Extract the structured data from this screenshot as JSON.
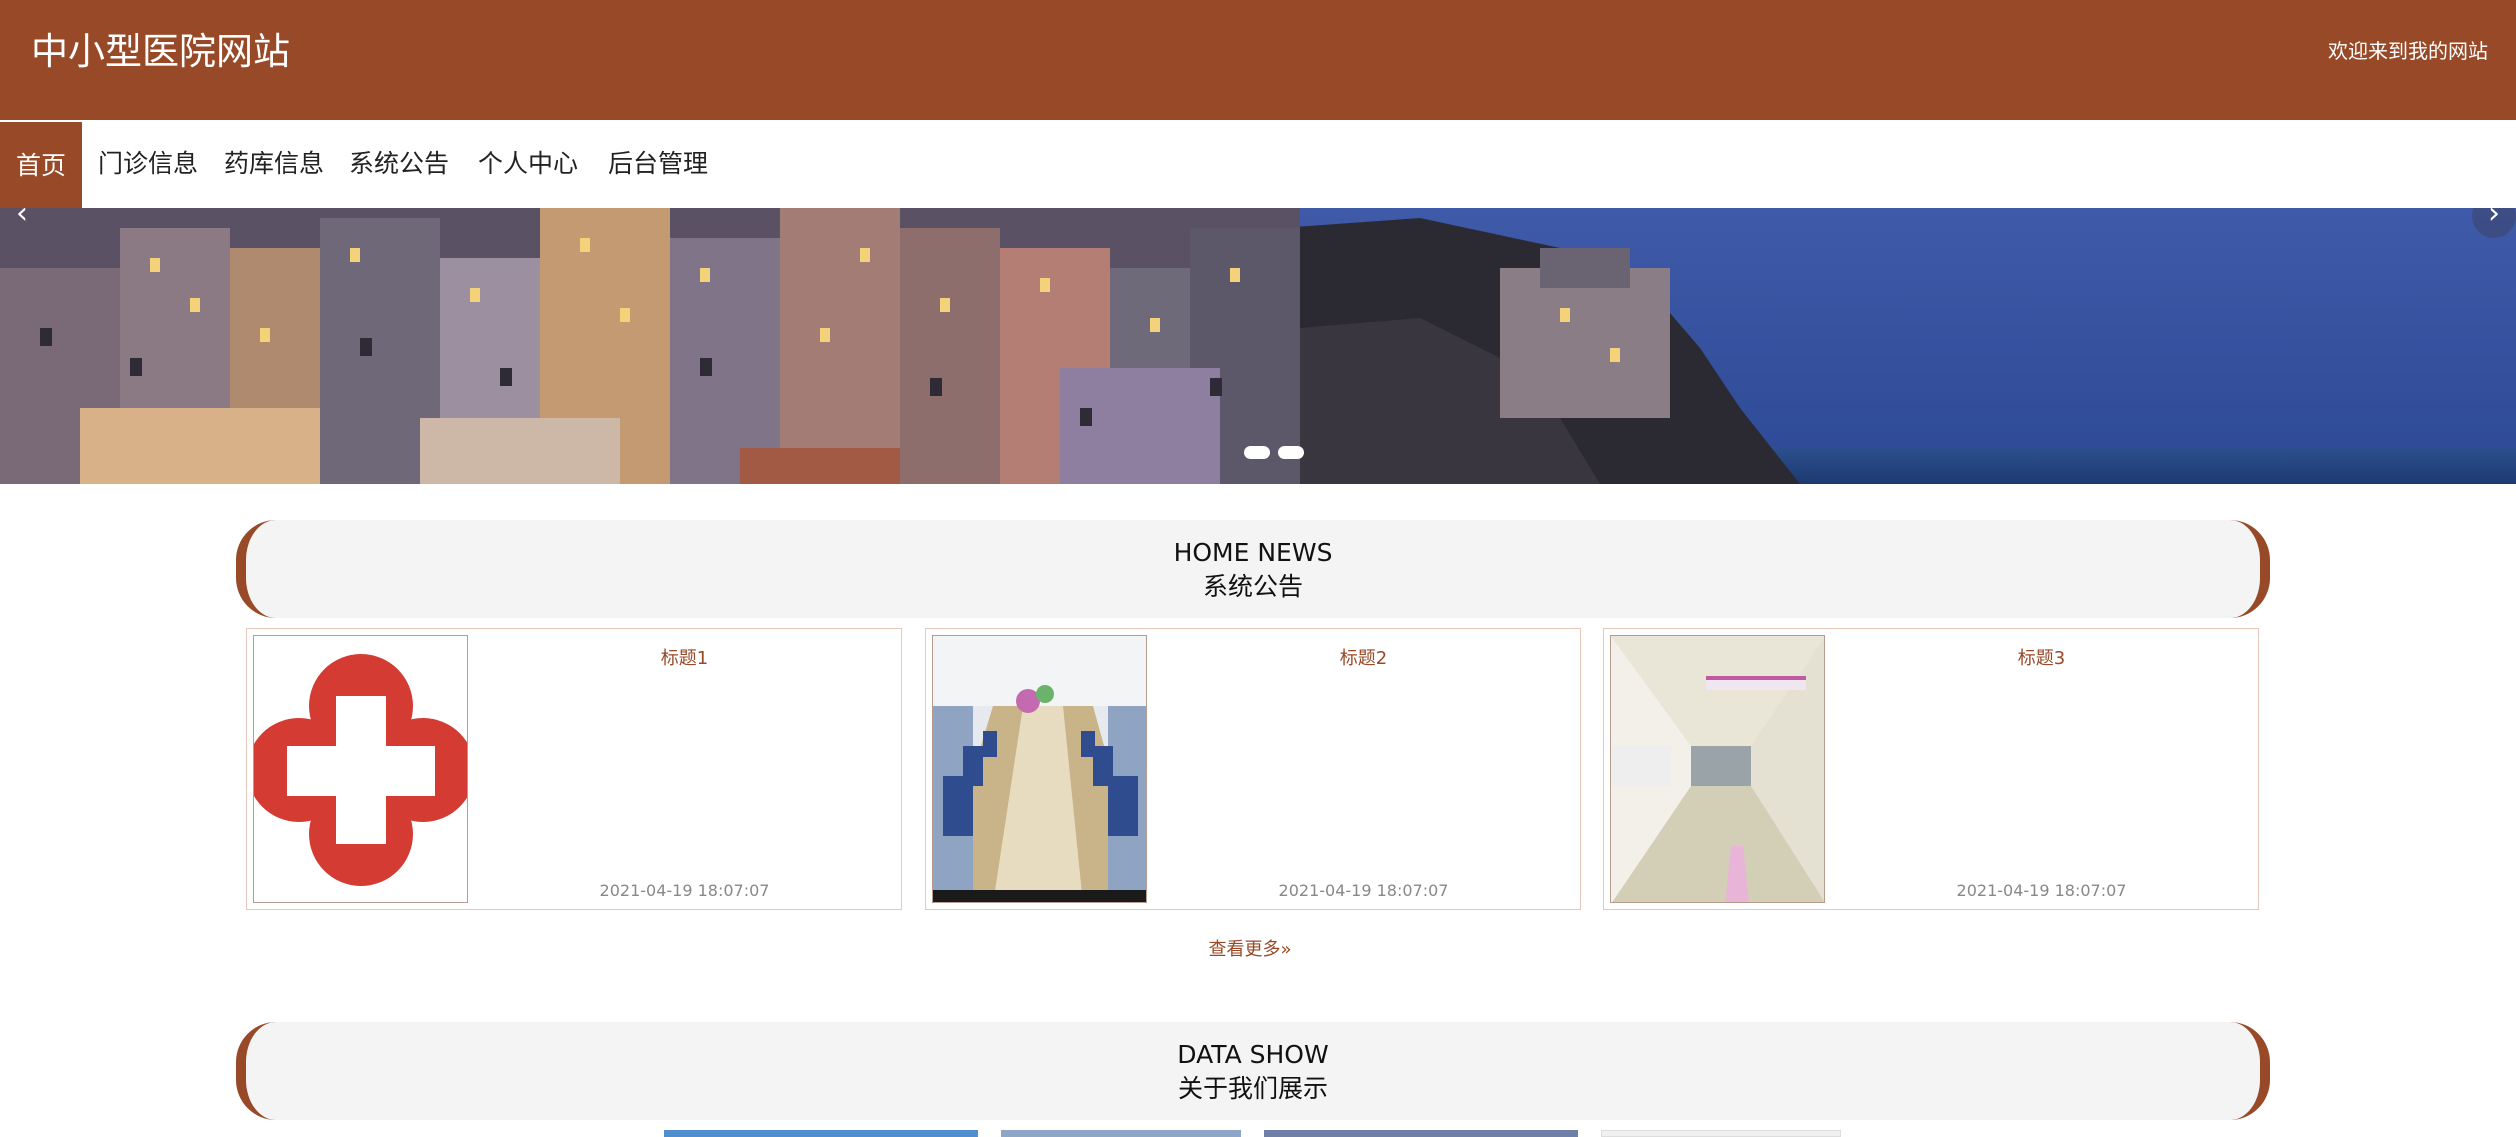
{
  "header": {
    "site_title": "中小型医院网站",
    "welcome": "欢迎来到我的网站"
  },
  "nav": {
    "items": [
      "首页",
      "门诊信息",
      "药库信息",
      "系统公告",
      "个人中心",
      "后台管理"
    ],
    "active_index": 0
  },
  "banner": {
    "prev_icon": "chevron-left-icon",
    "next_icon": "chevron-right-icon",
    "slide_count": 2,
    "active_slide": 0
  },
  "news": {
    "title_en": "HOME NEWS",
    "title_cn": "系统公告",
    "cards": [
      {
        "title": "标题1",
        "date": "2021-04-19 18:07:07",
        "image": "red-cross-logo"
      },
      {
        "title": "标题2",
        "date": "2021-04-19 18:07:07",
        "image": "infusion-room-photo"
      },
      {
        "title": "标题3",
        "date": "2021-04-19 18:07:07",
        "image": "hospital-corridor-photo"
      }
    ],
    "more_label": "查看更多",
    "more_icon": "double-chevron-right-icon"
  },
  "data_show": {
    "title_en": "DATA SHOW",
    "title_cn": "关于我们展示"
  },
  "colors": {
    "brand": "#974928",
    "section_bg": "#f5f4f4",
    "card_border": "#e8c8bd"
  }
}
